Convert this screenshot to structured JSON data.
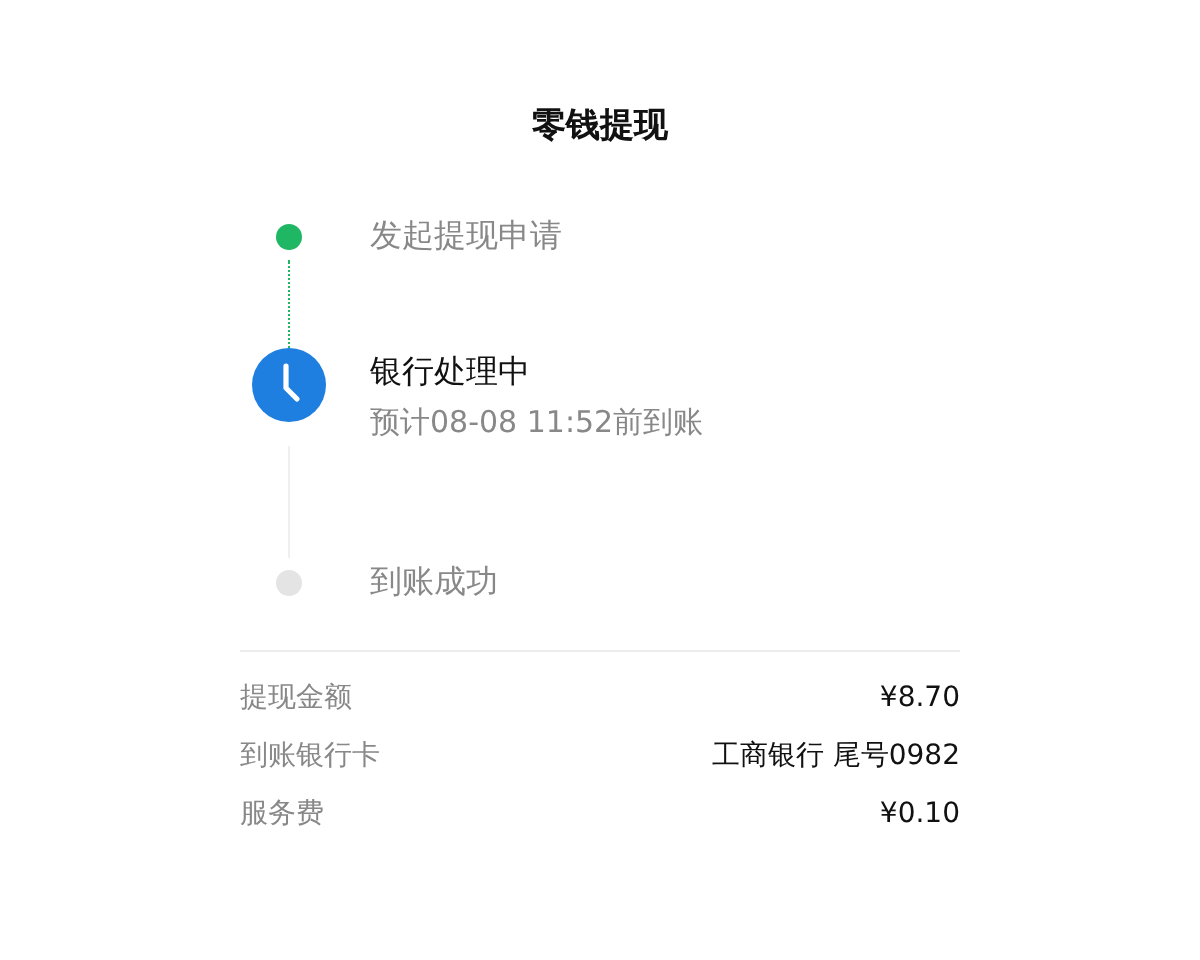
{
  "title": "零钱提现",
  "steps": [
    {
      "kind": "done",
      "label": "发起提现申请"
    },
    {
      "kind": "current",
      "label": "银行处理中",
      "detail": "预计08-08 11:52前到账"
    },
    {
      "kind": "pending",
      "label": "到账成功"
    }
  ],
  "details": [
    {
      "label": "提现金额",
      "value": "¥8.70"
    },
    {
      "label": "到账银行卡",
      "value": "工商银行 尾号0982"
    },
    {
      "label": "服务费",
      "value": "¥0.10"
    }
  ]
}
